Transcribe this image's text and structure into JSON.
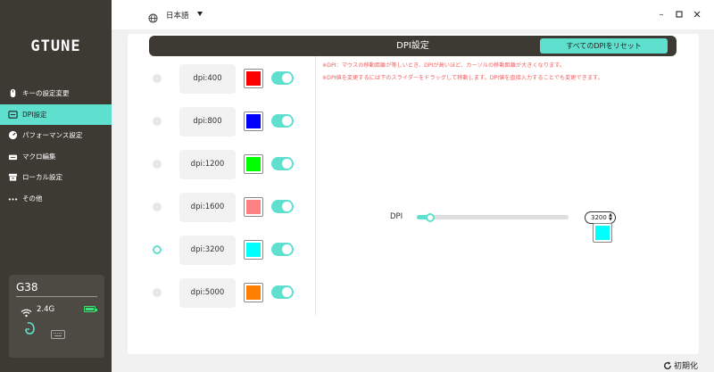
{
  "app": {
    "logo": "GTUNE"
  },
  "sidebar": {
    "items": [
      {
        "label": "キーの設定変更",
        "icon": "mouse-icon"
      },
      {
        "label": "DPI設定",
        "icon": "dpi-icon"
      },
      {
        "label": "パフォーマンス設定",
        "icon": "speedometer-icon"
      },
      {
        "label": "マクロ編集",
        "icon": "macro-icon"
      },
      {
        "label": "ローカル設定",
        "icon": "local-settings-icon"
      },
      {
        "label": "その他",
        "icon": "more-icon"
      }
    ],
    "active_index": 1
  },
  "device": {
    "name": "G38",
    "band": "2.4G",
    "battery_level": 0.9
  },
  "topbar": {
    "language": "日本語"
  },
  "header": {
    "title": "DPI設定",
    "reset_all": "すべてのDPIをリセット"
  },
  "dpi_levels": [
    {
      "label": "dpi:400",
      "color": "#ff0000",
      "enabled": true,
      "selected": false
    },
    {
      "label": "dpi:800",
      "color": "#0000ff",
      "enabled": true,
      "selected": false
    },
    {
      "label": "dpi:1200",
      "color": "#00ff00",
      "enabled": true,
      "selected": false
    },
    {
      "label": "dpi:1600",
      "color": "#ff8080",
      "enabled": true,
      "selected": false
    },
    {
      "label": "dpi:3200",
      "color": "#00ffff",
      "enabled": true,
      "selected": true
    },
    {
      "label": "dpi:5000",
      "color": "#ff8000",
      "enabled": true,
      "selected": false
    }
  ],
  "notes": [
    "※DPI：マウスの移動距離が等しいとき、DPIが高いほど、カーソルの移動距離が大きくなります。",
    "※DPI値を変更するには下のスライダーをドラッグして移動します。DPI値を直接入力することでも変更できます。"
  ],
  "slider": {
    "label": "DPI",
    "value": "3200",
    "fraction": 0.09,
    "color": "#00ffff"
  },
  "footer": {
    "init_label": "初期化"
  },
  "colors": {
    "accent": "#5fe0cf",
    "dark": "#3c3a33",
    "note": "#f06060"
  }
}
